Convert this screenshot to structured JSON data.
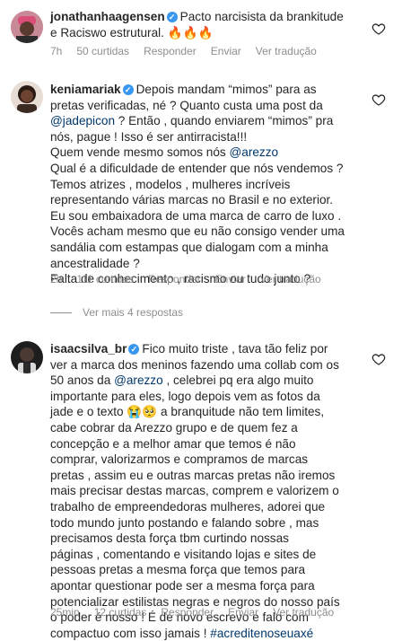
{
  "comments": [
    {
      "username": "jonathanhaagensen",
      "text_a": "Pacto narcisista da brankitude",
      "text_b": "e Raciswo estrutural. 🔥🔥🔥",
      "time": "7h",
      "likes": "50 curtidas",
      "reply": "Responder",
      "send": "Enviar",
      "translate": "Ver tradução"
    },
    {
      "username": "keniamariak",
      "lines": [
        "Depois mandam “mimos” para as",
        "pretas verificadas, né ? Quanto custa uma post da"
      ],
      "mention1": "@jadepicon",
      "line3_rest": " ? Então , quando enviarem “mimos” pra",
      "line4": "nós, pague ! Isso é ser antirracista!!!",
      "line5_pre": "Quem vende mesmo somos nós ",
      "mention2": "@arezzo",
      "para2": [
        "Qual é a dificuldade de entender que nós vendemos ?",
        "Temos atrizes , modelos , mulheres incríveis",
        "representando várias marcas no Brasil e no exterior.",
        "Eu sou embaixadora de uma marca de carro de luxo .",
        "Vocês acham mesmo que eu não consigo vender uma",
        "sandália com estampas que dialogam com a minha",
        "ancestralidade ?",
        "Falta de conhecimento ,  racismo ou tudo junto ?"
      ],
      "time": "2h",
      "likes": "111 curtidas",
      "reply": "Responder",
      "send": "Enviar",
      "translate": "Ver tradução"
    },
    {
      "username": "isaacsilva_br",
      "line1": "Fico muito triste , tava tão feliz por",
      "line2": "ver a marca dos meninos fazendo uma collab com os",
      "line3_pre": "50 anos da ",
      "mention": "@arezzo",
      "line3_post": " , celebrei pq era algo muito",
      "lines": [
        "importante para eles, logo depois vem as fotos da",
        "jade e o texto 😭🥺  a branquitude não tem limites,",
        "cabe cobrar da Arezzo grupo e de quem fez a",
        "concepção e a melhor amar que temos é não",
        "comprar, valorizarmos e compramos de marcas",
        "pretas , assim eu e outras marcas pretas não iremos",
        "mais precisar destas marcas, comprem e valorizem o",
        "trabalho de empreendedoras mulheres, adorei que",
        "todo mundo junto postando e falando sobre , mas",
        "precisamos desta força tbm curtindo nossas",
        "páginas , comentando e visitando lojas e sites de",
        "pessoas pretas a mesma força que temos para",
        "apontar questionar pode ser a mesma força para",
        "potencializar estilistas negras e negros do nosso país",
        "o poder é nosso ! É de novo escrevo e falo com"
      ],
      "last_pre": "compactuo com isso jamais ! ",
      "hashtag": "#acreditenoseuaxé",
      "time": "25min",
      "likes": "12 curtidas",
      "reply": "Responder",
      "send": "Enviar",
      "translate": "Ver tradução"
    }
  ],
  "view_more": "Ver mais 4 respostas"
}
